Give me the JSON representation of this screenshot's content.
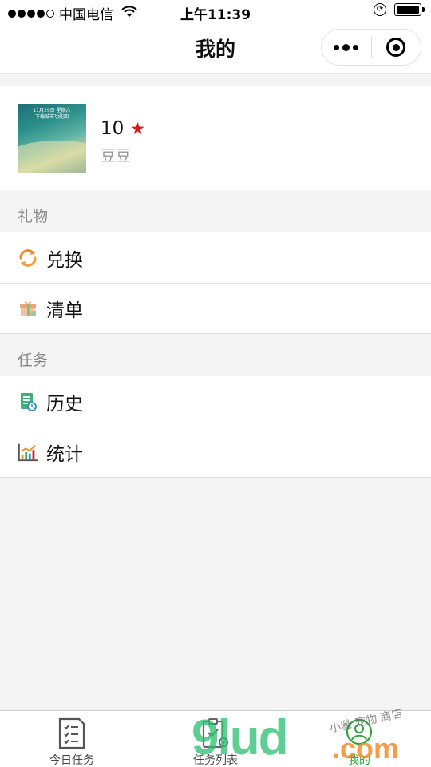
{
  "status_bar": {
    "carrier": "中国电信",
    "time": "上午11:39"
  },
  "nav": {
    "title": "我的"
  },
  "profile": {
    "points": "10",
    "star_icon": "★",
    "nickname": "豆豆",
    "avatar_text_line1": "11月29日 星期六",
    "avatar_text_line2": "下载城市功能四"
  },
  "sections": [
    {
      "header": "礼物",
      "items": [
        {
          "label": "兑换",
          "icon": "refresh-icon"
        },
        {
          "label": "清单",
          "icon": "gift-icon"
        }
      ]
    },
    {
      "header": "任务",
      "items": [
        {
          "label": "历史",
          "icon": "history-document-icon"
        },
        {
          "label": "统计",
          "icon": "chart-icon"
        }
      ]
    }
  ],
  "tabs": [
    {
      "label": "今日任务",
      "icon": "checklist-icon",
      "active": false
    },
    {
      "label": "任务列表",
      "icon": "clipboard-gear-icon",
      "active": false
    },
    {
      "label": "我的",
      "icon": "person-icon",
      "active": true
    }
  ],
  "watermark": {
    "brand": "9lud",
    "domain": ".com",
    "script": "小雅 宠物 商店"
  },
  "colors": {
    "accent_green": "#2fa53f",
    "star_red": "#e0161c"
  }
}
